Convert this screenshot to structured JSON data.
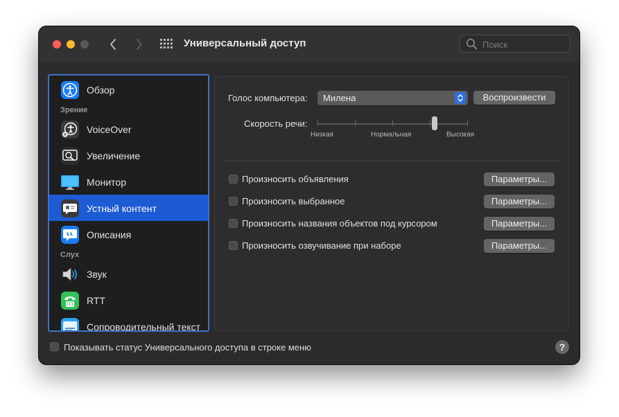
{
  "window": {
    "title": "Универсальный доступ",
    "search_placeholder": "Поиск"
  },
  "sidebar": {
    "items": [
      {
        "label": "Обзор",
        "icon": "accessibility-icon"
      },
      {
        "header": "Зрение"
      },
      {
        "label": "VoiceOver",
        "icon": "voiceover-icon"
      },
      {
        "label": "Увеличение",
        "icon": "zoom-icon"
      },
      {
        "label": "Монитор",
        "icon": "monitor-icon"
      },
      {
        "label": "Устный контент",
        "icon": "spoken-content-icon",
        "selected": true
      },
      {
        "label": "Описания",
        "icon": "descriptions-icon"
      },
      {
        "header": "Слух"
      },
      {
        "label": "Звук",
        "icon": "speaker-icon"
      },
      {
        "label": "RTT",
        "icon": "rtt-phone-icon"
      },
      {
        "label": "Сопроводительный текст",
        "icon": "captions-icon"
      }
    ]
  },
  "panel": {
    "voice_label": "Голос компьютера:",
    "voice_value": "Милена",
    "play_button": "Воспроизвести",
    "rate_label": "Скорость речи:",
    "rate_low": "Низкая",
    "rate_normal": "Нормальная",
    "rate_high": "Высокая",
    "rate_value_fraction": 0.78,
    "options": [
      {
        "label": "Произносить объявления",
        "checked": false,
        "button": "Параметры..."
      },
      {
        "label": "Произносить выбранное",
        "checked": false,
        "button": "Параметры..."
      },
      {
        "label": "Произносить названия объектов под курсором",
        "checked": false,
        "button": "Параметры..."
      },
      {
        "label": "Произносить озвучивание при наборе",
        "checked": false,
        "button": "Параметры..."
      }
    ]
  },
  "footer": {
    "menu_status_label": "Показывать статус Универсального доступа в строке меню",
    "menu_status_checked": false,
    "help": "?"
  },
  "colors": {
    "accent": "#1c5bd4",
    "sidebar_border": "#3b74c4",
    "window_bg": "#2b2b2d"
  }
}
